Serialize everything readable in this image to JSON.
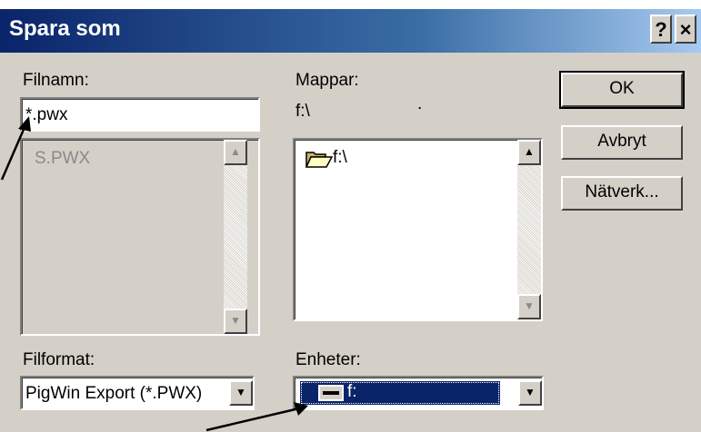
{
  "window": {
    "title": "Spara som"
  },
  "titlebar_buttons": {
    "help": "?",
    "close": "×"
  },
  "filename": {
    "label": "Filnamn:",
    "value": "*.pwx",
    "list_items": [
      "S.PWX"
    ]
  },
  "folders": {
    "label": "Mappar:",
    "current_path": "f:\\",
    "dot": ".",
    "tree_items": [
      {
        "label": "f:\\",
        "icon": "open-folder-icon"
      }
    ]
  },
  "buttons": {
    "ok": "OK",
    "cancel": "Avbryt",
    "network": "Nätverk..."
  },
  "file_format": {
    "label": "Filformat:",
    "value": "PigWin Export (*.PWX)"
  },
  "drives": {
    "label": "Enheter:",
    "value": "f:",
    "icon": "drive-icon"
  },
  "colors": {
    "titlebar_start": "#0a246a",
    "titlebar_end": "#a6caf0",
    "face": "#d4d0c8",
    "selection": "#0a246a"
  }
}
